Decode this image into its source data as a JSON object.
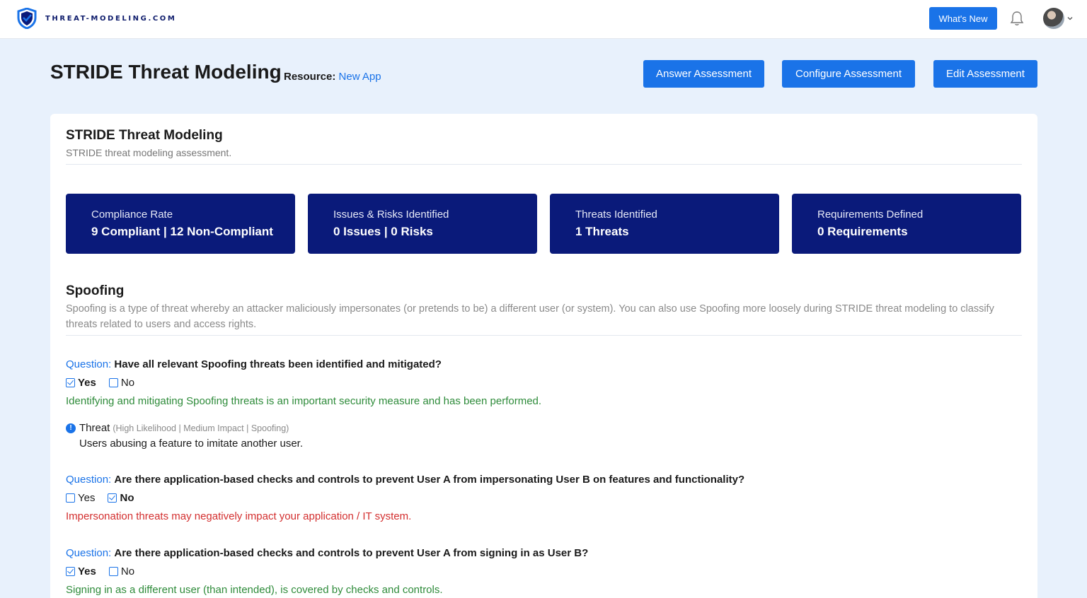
{
  "app": {
    "logo_text": "THREAT-MODELING.COM"
  },
  "topbar": {
    "whats_new": "What's New"
  },
  "header": {
    "title": "STRIDE Threat Modeling",
    "resource_label": "Resource:",
    "resource_value": "New App",
    "buttons": [
      "Answer Assessment",
      "Configure Assessment",
      "Edit Assessment"
    ]
  },
  "card": {
    "title": "STRIDE Threat Modeling",
    "subtitle": "STRIDE threat modeling assessment.",
    "stats": [
      {
        "label": "Compliance Rate",
        "value": "9 Compliant | 12 Non-Compliant"
      },
      {
        "label": "Issues & Risks Identified",
        "value": "0 Issues | 0 Risks"
      },
      {
        "label": "Threats Identified",
        "value": "1 Threats"
      },
      {
        "label": "Requirements Defined",
        "value": "0 Requirements"
      }
    ],
    "section": {
      "title": "Spoofing",
      "description": "Spoofing is a type of threat whereby an attacker maliciously impersonates (or pretends to be) a different user (or system). You can also use Spoofing more loosely during STRIDE threat modeling to classify threats related to users and access rights."
    },
    "question_label": "Question:",
    "questions": [
      {
        "text": "Have all relevant Spoofing threats been identified and mitigated?",
        "yes": "Yes",
        "no": "No",
        "answer": "yes",
        "message": "Identifying and mitigating Spoofing threats is an important security measure and has been performed."
      },
      {
        "text": "Are there application-based checks and controls to prevent User A from impersonating User B on features and functionality?",
        "yes": "Yes",
        "no": "No",
        "answer": "no",
        "message": "Impersonation threats may negatively impact your application / IT system."
      },
      {
        "text": "Are there application-based checks and controls to prevent User A from signing in as User B?",
        "yes": "Yes",
        "no": "No",
        "answer": "yes",
        "message": "Signing in as a different user (than intended), is covered by checks and controls."
      }
    ],
    "threat": {
      "label": "Threat",
      "meta": "(High Likelihood | Medium Impact | Spoofing)",
      "description": "Users abusing a feature to imitate another user."
    }
  },
  "colors": {
    "accent": "#1a73e8",
    "stat_bg": "#0a1a7a",
    "ok": "#2e8b3a",
    "bad": "#d32f2f"
  }
}
